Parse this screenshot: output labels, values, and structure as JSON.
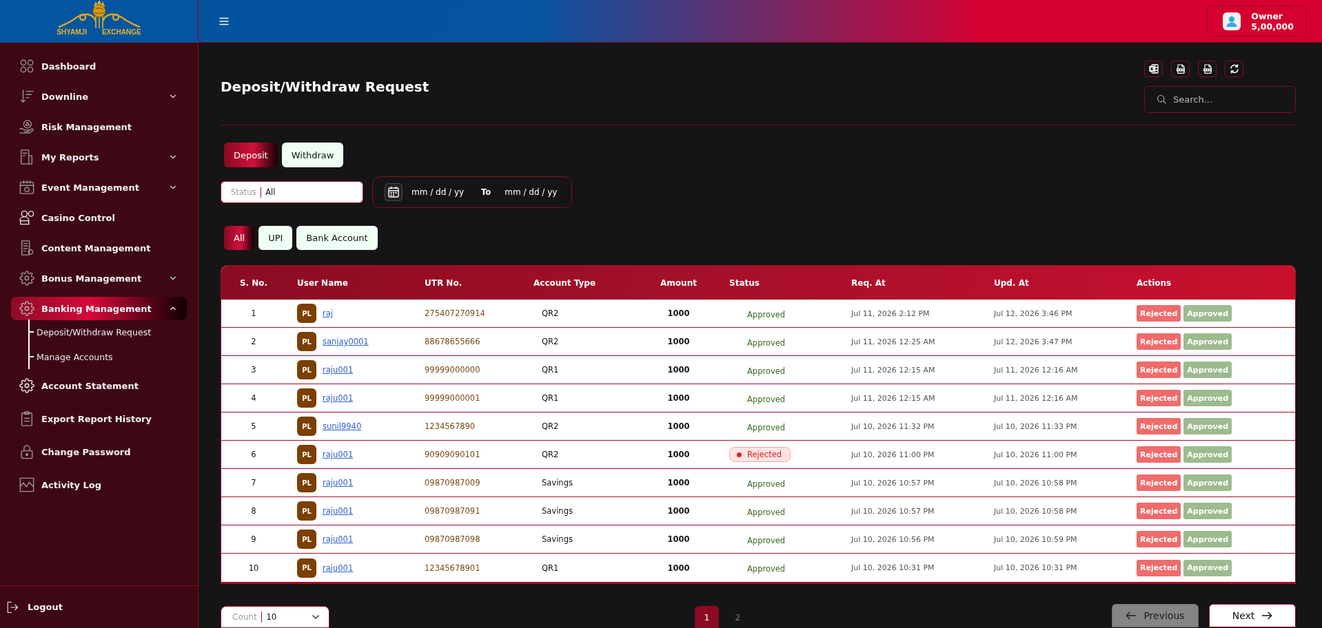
{
  "logo": {
    "words": [
      "SHYAMJI",
      "EXCHANGE"
    ]
  },
  "sidebar": {
    "items": [
      {
        "label": "Dashboard",
        "kind": "link",
        "selected": false
      },
      {
        "label": "Downline",
        "kind": "group",
        "expanded": false,
        "selected": false
      },
      {
        "label": "Risk Management",
        "kind": "link",
        "selected": false
      },
      {
        "label": "My Reports",
        "kind": "group",
        "expanded": false,
        "selected": false
      },
      {
        "label": "Event Management",
        "kind": "group",
        "expanded": false,
        "selected": false
      },
      {
        "label": "Casino Control",
        "kind": "link",
        "selected": false
      },
      {
        "label": "Content Management",
        "kind": "link",
        "selected": false
      },
      {
        "label": "Bonus Management",
        "kind": "group",
        "expanded": false,
        "selected": false
      },
      {
        "label": "Banking Management",
        "kind": "group",
        "expanded": true,
        "selected": true,
        "children": [
          {
            "label": "Deposit/Withdraw Request",
            "selected": false
          },
          {
            "label": "Manage Accounts",
            "selected": false
          }
        ]
      },
      {
        "label": "Account Statement",
        "kind": "link",
        "selected": false
      },
      {
        "label": "Export Report History",
        "kind": "link",
        "selected": false
      },
      {
        "label": "Change Password",
        "kind": "link",
        "selected": false
      },
      {
        "label": "Activity Log",
        "kind": "link",
        "selected": false
      }
    ],
    "logout": "Logout"
  },
  "header": {
    "user": {
      "role": "Owner",
      "balance": "5,00,000"
    }
  },
  "page": {
    "title": "Deposit/Withdraw Request",
    "search": {
      "placeholder": "Search..."
    },
    "request_types": [
      {
        "label": "Deposit",
        "selected": true
      },
      {
        "label": "Withdraw",
        "selected": false
      }
    ],
    "filters": {
      "status": {
        "label": "Status",
        "value": "All"
      },
      "date_from": {
        "placeholder": "mm / dd / yy"
      },
      "date_separator": "To",
      "date_to": {
        "placeholder": "mm / dd / yy"
      }
    },
    "methods": [
      {
        "label": "All",
        "selected": true
      },
      {
        "label": "UPI",
        "selected": false
      },
      {
        "label": "Bank Account",
        "selected": false
      }
    ],
    "table": {
      "columns": [
        "S. No.",
        "User Name",
        "UTR No.",
        "Account Type",
        "Amount",
        "Status",
        "Req. At",
        "Upd. At",
        "Actions"
      ],
      "rows": [
        {
          "sno": "1",
          "avatar": "PL",
          "user": "raj",
          "utr": "275407270914",
          "account_type": "QR2",
          "amount": "1000",
          "status": {
            "label": "Approved",
            "kind": "approved"
          },
          "req_at": "Jul 11, 2026 2:12 PM",
          "upd_at": "Jul 12, 2026 3:46 PM",
          "actions": [
            {
              "label": "Rejected",
              "kind": "reject"
            },
            {
              "label": "Approved",
              "kind": "approve"
            }
          ]
        },
        {
          "sno": "2",
          "avatar": "PL",
          "user": "sanjay0001",
          "utr": "88678655666",
          "account_type": "QR2",
          "amount": "1000",
          "status": {
            "label": "Approved",
            "kind": "approved"
          },
          "req_at": "Jul 11, 2026 12:25 AM",
          "upd_at": "Jul 12, 2026 3:47 PM",
          "actions": [
            {
              "label": "Rejected",
              "kind": "reject"
            },
            {
              "label": "Approved",
              "kind": "approve"
            }
          ]
        },
        {
          "sno": "3",
          "avatar": "PL",
          "user": "raju001",
          "utr": "99999000000",
          "account_type": "QR1",
          "amount": "1000",
          "status": {
            "label": "Approved",
            "kind": "approved"
          },
          "req_at": "Jul 11, 2026 12:15 AM",
          "upd_at": "Jul 11, 2026 12:16 AM",
          "actions": [
            {
              "label": "Rejected",
              "kind": "reject"
            },
            {
              "label": "Approved",
              "kind": "approve"
            }
          ]
        },
        {
          "sno": "4",
          "avatar": "PL",
          "user": "raju001",
          "utr": "99999000001",
          "account_type": "QR1",
          "amount": "1000",
          "status": {
            "label": "Approved",
            "kind": "approved"
          },
          "req_at": "Jul 11, 2026 12:15 AM",
          "upd_at": "Jul 11, 2026 12:16 AM",
          "actions": [
            {
              "label": "Rejected",
              "kind": "reject"
            },
            {
              "label": "Approved",
              "kind": "approve"
            }
          ]
        },
        {
          "sno": "5",
          "avatar": "PL",
          "user": "sunil9940",
          "utr": "1234567890",
          "account_type": "QR2",
          "amount": "1000",
          "status": {
            "label": "Approved",
            "kind": "approved"
          },
          "req_at": "Jul 10, 2026 11:32 PM",
          "upd_at": "Jul 10, 2026 11:33 PM",
          "actions": [
            {
              "label": "Rejected",
              "kind": "reject"
            },
            {
              "label": "Approved",
              "kind": "approve"
            }
          ]
        },
        {
          "sno": "6",
          "avatar": "PL",
          "user": "raju001",
          "utr": "90909090101",
          "account_type": "QR2",
          "amount": "1000",
          "status": {
            "label": "Rejected",
            "kind": "rejected"
          },
          "req_at": "Jul 10, 2026 11:00 PM",
          "upd_at": "Jul 10, 2026 11:00 PM",
          "actions": [
            {
              "label": "Rejected",
              "kind": "reject"
            },
            {
              "label": "Approved",
              "kind": "approve"
            }
          ]
        },
        {
          "sno": "7",
          "avatar": "PL",
          "user": "raju001",
          "utr": "09870987009",
          "account_type": "Savings",
          "amount": "1000",
          "status": {
            "label": "Approved",
            "kind": "approved"
          },
          "req_at": "Jul 10, 2026 10:57 PM",
          "upd_at": "Jul 10, 2026 10:58 PM",
          "actions": [
            {
              "label": "Rejected",
              "kind": "reject"
            },
            {
              "label": "Approved",
              "kind": "approve"
            }
          ]
        },
        {
          "sno": "8",
          "avatar": "PL",
          "user": "raju001",
          "utr": "09870987091",
          "account_type": "Savings",
          "amount": "1000",
          "status": {
            "label": "Approved",
            "kind": "approved"
          },
          "req_at": "Jul 10, 2026 10:57 PM",
          "upd_at": "Jul 10, 2026 10:58 PM",
          "actions": [
            {
              "label": "Rejected",
              "kind": "reject"
            },
            {
              "label": "Approved",
              "kind": "approve"
            }
          ]
        },
        {
          "sno": "9",
          "avatar": "PL",
          "user": "raju001",
          "utr": "09870987098",
          "account_type": "Savings",
          "amount": "1000",
          "status": {
            "label": "Approved",
            "kind": "approved"
          },
          "req_at": "Jul 10, 2026 10:56 PM",
          "upd_at": "Jul 10, 2026 10:59 PM",
          "actions": [
            {
              "label": "Rejected",
              "kind": "reject"
            },
            {
              "label": "Approved",
              "kind": "approve"
            }
          ]
        },
        {
          "sno": "10",
          "avatar": "PL",
          "user": "raju001",
          "utr": "12345678901",
          "account_type": "QR1",
          "amount": "1000",
          "status": {
            "label": "Approved",
            "kind": "approved"
          },
          "req_at": "Jul 10, 2026 10:31 PM",
          "upd_at": "Jul 10, 2026 10:31 PM",
          "actions": [
            {
              "label": "Rejected",
              "kind": "reject"
            },
            {
              "label": "Approved",
              "kind": "approve"
            }
          ]
        }
      ]
    },
    "footer": {
      "count": {
        "label": "Count",
        "value": "10"
      },
      "pages": [
        {
          "label": "1",
          "selected": true
        },
        {
          "label": "2",
          "selected": false
        }
      ],
      "previous": {
        "label": "Previous",
        "disabled": true
      },
      "next": {
        "label": "Next",
        "disabled": false
      }
    }
  }
}
